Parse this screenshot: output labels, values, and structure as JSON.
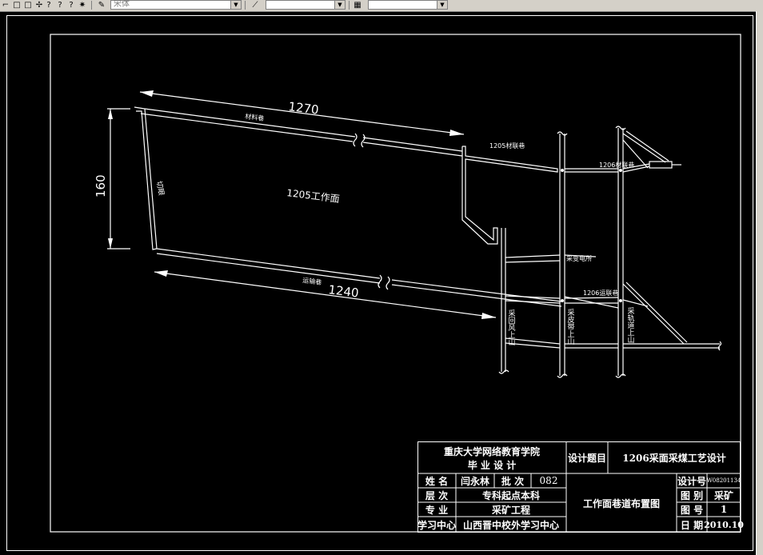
{
  "toolbar": {
    "font_combo": "宋体",
    "combo2": "",
    "combo3": ""
  },
  "drawing": {
    "dim_top": "1270",
    "dim_left": "160",
    "dim_bottom": "1240",
    "panel_label": "1205工作面",
    "label_cut": "切眼",
    "label_material_lane": "材料巷",
    "label_transport_lane": "运输巷",
    "label_1205_material_link": "1205材联巷",
    "label_1206_material_link": "1206材联巷",
    "label_substation": "采变电所",
    "label_1206_transport_link": "1206运联巷",
    "vert_return": "采回风上山",
    "vert_track": "采皮带上山",
    "vert_rail": "采轨道上山"
  },
  "title_block": {
    "school": "重庆大学网络教育学院",
    "course": "毕 业 设 计",
    "design_topic_label": "设计题目",
    "design_topic": "1206采面采煤工艺设计",
    "name_label": "姓  名",
    "name": "闫永林",
    "batch_label": "批  次",
    "batch": "082",
    "level_label": "层  次",
    "level": "专科起点本科",
    "major_label": "专  业",
    "major": "采矿工程",
    "center_label": "学习中心",
    "center": "山西晋中校外学习中心",
    "drawing_title": "工作面巷道布置图",
    "design_no_label": "设计号",
    "design_no": "W08201134",
    "category_label": "图 别",
    "category": "采矿",
    "sheet_label": "图 号",
    "sheet": "1",
    "date_label": "日 期",
    "date": "2010.10"
  }
}
